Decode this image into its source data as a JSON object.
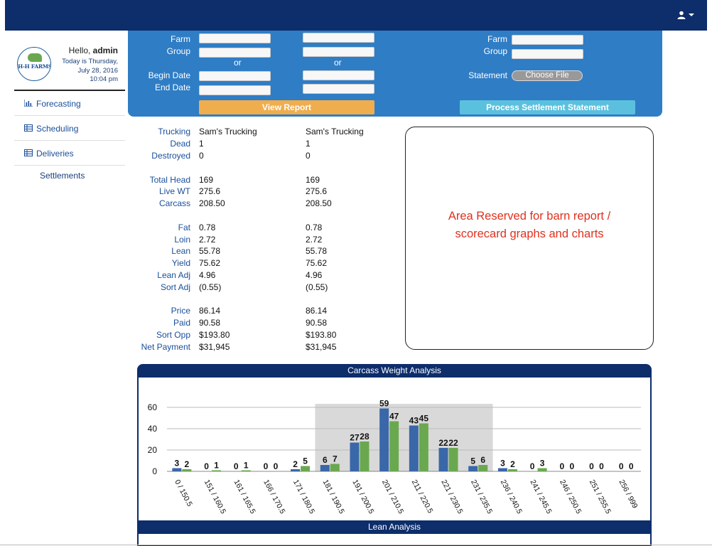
{
  "header": {
    "user_icon": "user-icon"
  },
  "profile": {
    "logo_text": "H-H FARMS",
    "hello": "Hello, ",
    "username": "admin",
    "today": "Today is Thursday,",
    "date": "July 28, 2016",
    "time": "10:04 pm"
  },
  "nav": {
    "items": [
      {
        "label": "Forecasting",
        "icon": "bar-chart-icon"
      },
      {
        "label": "Scheduling",
        "icon": "table-icon"
      },
      {
        "label": "Deliveries",
        "icon": "table-icon"
      }
    ],
    "sub_label": "Settlements"
  },
  "report_form": {
    "farm_label": "Farm",
    "group_label": "Group",
    "or_label": "or",
    "begin_date_label": "Begin Date",
    "end_date_label": "End Date",
    "view_report_button": "View Report",
    "farm_1": "",
    "farm_2": "",
    "group_1": "",
    "group_2": "",
    "begin_1": "",
    "begin_2": "",
    "end_1": "",
    "end_2": ""
  },
  "settlement_form": {
    "farm_label": "Farm",
    "group_label": "Group",
    "statement_label": "Statement",
    "choose_file_button": "Choose File",
    "process_button": "Process Settlement Statement",
    "farm": "",
    "group": ""
  },
  "stats": [
    {
      "label": "Trucking",
      "v1": "Sam's Trucking",
      "v2": "Sam's Trucking"
    },
    {
      "label": "Dead",
      "v1": "1",
      "v2": "1"
    },
    {
      "label": "Destroyed",
      "v1": "0",
      "v2": "0"
    },
    {
      "label": "Total Head",
      "v1": "169",
      "v2": "169"
    },
    {
      "label": "Live WT",
      "v1": "275.6",
      "v2": "275.6"
    },
    {
      "label": "Carcass",
      "v1": "208.50",
      "v2": "208.50"
    },
    {
      "label": "Fat",
      "v1": "0.78",
      "v2": "0.78"
    },
    {
      "label": "Loin",
      "v1": "2.72",
      "v2": "2.72"
    },
    {
      "label": "Lean",
      "v1": "55.78",
      "v2": "55.78"
    },
    {
      "label": "Yield",
      "v1": "75.62",
      "v2": "75.62"
    },
    {
      "label": "Lean Adj",
      "v1": "4.96",
      "v2": "4.96"
    },
    {
      "label": "Sort Adj",
      "v1": "(0.55)",
      "v2": "(0.55)"
    },
    {
      "label": "Price",
      "v1": "86.14",
      "v2": "86.14"
    },
    {
      "label": "Paid",
      "v1": "90.58",
      "v2": "90.58"
    },
    {
      "label": "Sort Opp",
      "v1": "$193.80",
      "v2": "$193.80"
    },
    {
      "label": "Net Payment",
      "v1": "$31,945",
      "v2": "$31,945"
    }
  ],
  "reserved_area": {
    "line1": "Area Reserved for barn report /",
    "line2": "scorecard graphs and charts"
  },
  "lean_analysis_title": "Lean Analysis",
  "chart_data": {
    "type": "bar",
    "title": "Carcass Weight Analysis",
    "categories": [
      "0 / 150.5",
      "151 / 160.5",
      "161 / 165.5",
      "166 / 170.5",
      "171 / 180.5",
      "181 / 190.5",
      "191 / 200.5",
      "201 / 210.5",
      "211 / 220.5",
      "221 / 230.5",
      "231 / 235.5",
      "236 / 240.5",
      "241 / 245.5",
      "246 / 250.5",
      "251 / 255.5",
      "256 / 999"
    ],
    "series": [
      {
        "values": [
          3,
          0,
          0,
          0,
          2,
          6,
          27,
          59,
          43,
          22,
          5,
          3,
          0,
          0,
          0,
          0
        ],
        "color": "#3a67a8"
      },
      {
        "values": [
          2,
          1,
          1,
          0,
          5,
          7,
          28,
          47,
          45,
          22,
          6,
          2,
          3,
          0,
          0,
          0
        ],
        "color": "#6aa84f"
      }
    ],
    "ylim": [
      0,
      70
    ],
    "yticks": [
      0,
      20,
      40,
      60
    ],
    "highlight_categories": [
      "181 / 190.5",
      "191 / 200.5",
      "201 / 210.5",
      "211 / 220.5",
      "221 / 230.5",
      "231 / 235.5"
    ],
    "highlight_color": "#d9d9d9",
    "grid": true
  }
}
